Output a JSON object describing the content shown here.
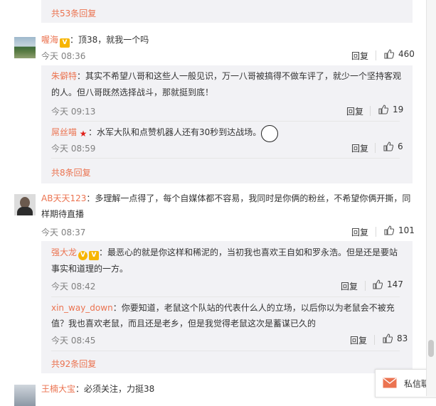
{
  "colors": {
    "accent": "#eb7350",
    "panel_bg": "#f2f2f5",
    "text": "#333333",
    "muted": "#808080"
  },
  "icons": {
    "like": "thumbs-up-icon",
    "message": "envelope-icon"
  },
  "top_more": "共53条回复",
  "threads": [
    {
      "author": "喔海",
      "text": "：顶38，就我一个吗",
      "time": "今天 08:36",
      "reply": "回复",
      "likes": "460",
      "replies": [
        {
          "author": "朱僻特",
          "line1": "：其实不希望八哥和这些人一般见识，万一八哥被搞得不做车评了，就少一个坚持客观",
          "line2": "的人。但八哥既然选择战斗，那就挺到底！",
          "time": "今天 09:13",
          "reply": "回复",
          "likes": "19"
        },
        {
          "author": "屌丝喵",
          "line1": "：水军大队和点赞机器人还有30秒到达战场。",
          "time": "今天 08:59",
          "reply": "回复",
          "likes": "6"
        }
      ],
      "more": "共8条回复"
    },
    {
      "author": "AB天天123",
      "line1": "：多理解一点得了，每个自媒体都不容易，我同时是你俩的粉丝，不希望你俩开撕，同",
      "line2": "样期待直播",
      "time": "今天 08:37",
      "reply": "回复",
      "likes": "101",
      "replies": [
        {
          "author": "强大龙",
          "line1": "：最恶心的就是你这样和稀泥的，当初我也喜欢王自如和罗永浩。但是还是要站",
          "line2": "事实和道理的一方。",
          "time": "今天 08:42",
          "reply": "回复",
          "likes": "147"
        },
        {
          "author": "xin_way_down",
          "line1": "：你要知道，老鼠这个队站的代表什么人的立场，以后你以为老鼠会不被充",
          "line2": "值？我也喜欢老鼠，而且还是老乡，但是我觉得老鼠这次是蓄谋已久的",
          "time": "今天 08:45",
          "reply": "回复",
          "likes": "83"
        }
      ],
      "more": "共92条回复"
    },
    {
      "author": "王楠大宝",
      "text": "：必须关注，力挺38"
    }
  ],
  "message_button": "私信聊"
}
